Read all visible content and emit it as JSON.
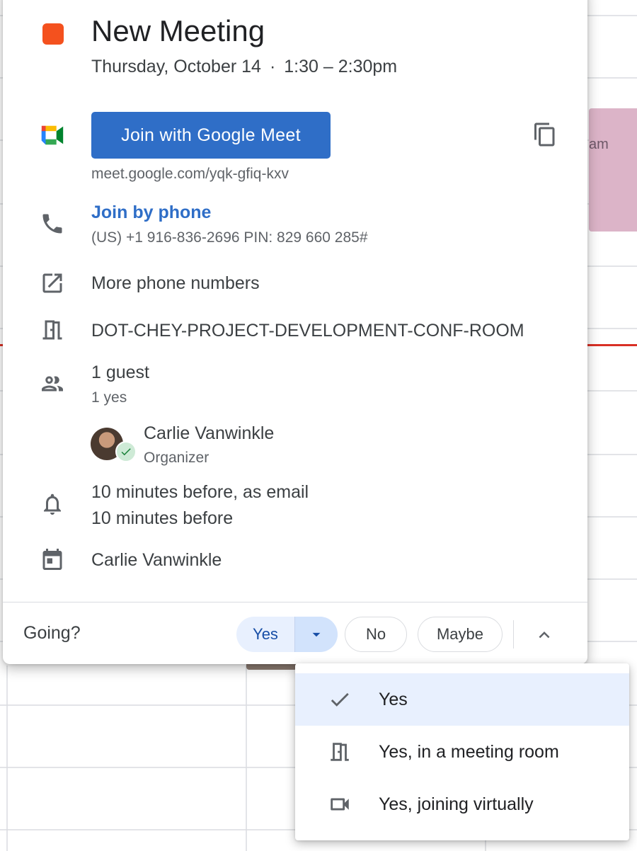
{
  "event": {
    "title": "New Meeting",
    "date": "Thursday, October 14",
    "time": "1:30 – 2:30pm",
    "color": "#f4511e"
  },
  "meet": {
    "join_label": "Join with Google Meet",
    "link": "meet.google.com/yqk-gfiq-kxv",
    "copy_icon": "copy-icon"
  },
  "phone": {
    "join_label": "Join by phone",
    "detail": "(US) +1 916-836-2696 PIN: 829 660 285#",
    "more_label": "More phone numbers"
  },
  "room": {
    "name": "DOT-CHEY-PROJECT-DEVELOPMENT-CONF-ROOM"
  },
  "guests": {
    "count_label": "1 guest",
    "summary": "1 yes",
    "list": [
      {
        "name": "Carlie Vanwinkle",
        "role": "Organizer"
      }
    ]
  },
  "reminders": {
    "items": [
      "10 minutes before, as email",
      "10 minutes before"
    ]
  },
  "calendar": {
    "owner": "Carlie Vanwinkle"
  },
  "rsvp": {
    "prompt": "Going?",
    "yes_label": "Yes",
    "no_label": "No",
    "maybe_label": "Maybe"
  },
  "rsvp_menu": {
    "items": [
      {
        "label": "Yes",
        "icon": "check-icon",
        "selected": true
      },
      {
        "label": "Yes, in a meeting room",
        "icon": "meeting-room-icon",
        "selected": false
      },
      {
        "label": "Yes, joining virtually",
        "icon": "video-camera-icon",
        "selected": false
      }
    ]
  },
  "background": {
    "event_snippet": "am",
    "event_color": "#dcb4c8",
    "now_line_color": "#d93025"
  }
}
